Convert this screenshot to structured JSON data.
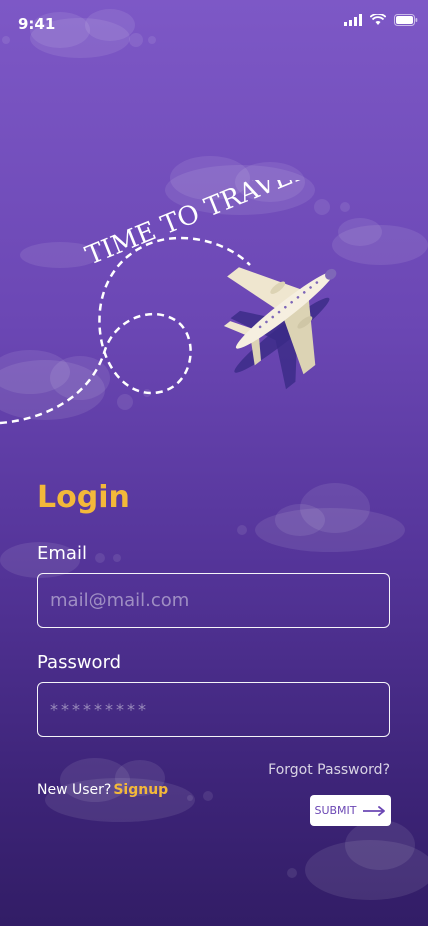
{
  "status_bar": {
    "time": "9:41"
  },
  "hero": {
    "tagline": "TIME TO TRAVEL"
  },
  "login": {
    "title": "Login",
    "email_label": "Email",
    "email_placeholder": "mail@mail.com",
    "password_label": "Password",
    "password_placeholder": "*********",
    "forgot_password": "Forgot Password?",
    "new_user_text": "New User?",
    "signup_link": "Signup",
    "submit_label": "SUBMIT"
  },
  "colors": {
    "accent": "#f3b83a",
    "bg_top": "#7d58c6",
    "bg_bottom": "#321d66",
    "button_text": "#6b47b4"
  }
}
